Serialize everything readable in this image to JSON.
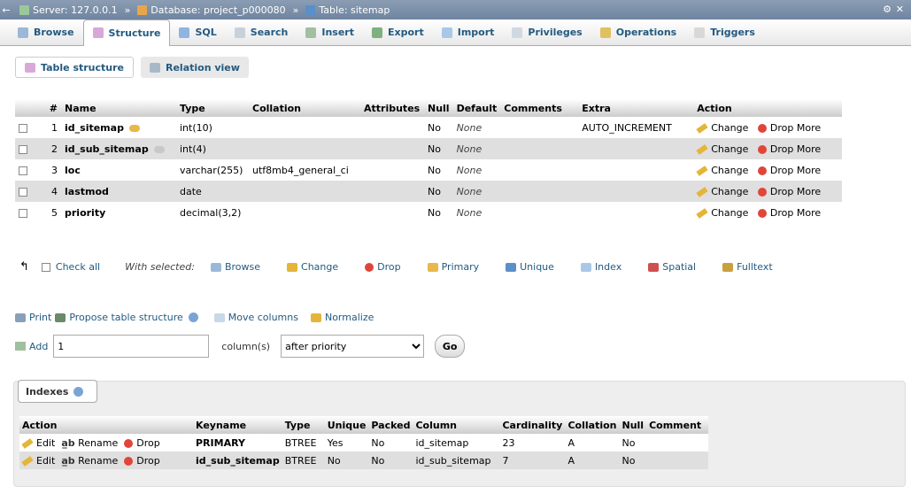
{
  "breadcrumb": {
    "server": "Server: 127.0.0.1",
    "database": "Database: project_p000080",
    "table": "Table: sitemap"
  },
  "tabs": [
    "Browse",
    "Structure",
    "SQL",
    "Search",
    "Insert",
    "Export",
    "Import",
    "Privileges",
    "Operations",
    "Triggers"
  ],
  "subtabs": {
    "table_structure": "Table structure",
    "relation_view": "Relation view"
  },
  "structure": {
    "headers": [
      "#",
      "Name",
      "Type",
      "Collation",
      "Attributes",
      "Null",
      "Default",
      "Comments",
      "Extra",
      "Action"
    ],
    "rows": [
      {
        "num": "1",
        "name": "id_sitemap",
        "type": "int(10)",
        "collation": "",
        "attributes": "",
        "null": "No",
        "default": "None",
        "comments": "",
        "extra": "AUTO_INCREMENT"
      },
      {
        "num": "2",
        "name": "id_sub_sitemap",
        "type": "int(4)",
        "collation": "",
        "attributes": "",
        "null": "No",
        "default": "None",
        "comments": "",
        "extra": ""
      },
      {
        "num": "3",
        "name": "loc",
        "type": "varchar(255)",
        "collation": "utf8mb4_general_ci",
        "attributes": "",
        "null": "No",
        "default": "None",
        "comments": "",
        "extra": ""
      },
      {
        "num": "4",
        "name": "lastmod",
        "type": "date",
        "collation": "",
        "attributes": "",
        "null": "No",
        "default": "None",
        "comments": "",
        "extra": ""
      },
      {
        "num": "5",
        "name": "priority",
        "type": "decimal(3,2)",
        "collation": "",
        "attributes": "",
        "null": "No",
        "default": "None",
        "comments": "",
        "extra": ""
      }
    ],
    "actions": {
      "change": "Change",
      "drop": "Drop",
      "more": "More"
    }
  },
  "with_selected": {
    "check_all": "Check all",
    "label": "With selected:",
    "items": [
      "Browse",
      "Change",
      "Drop",
      "Primary",
      "Unique",
      "Index",
      "Spatial",
      "Fulltext"
    ]
  },
  "misc": {
    "print": "Print",
    "propose": "Propose table structure",
    "move": "Move columns",
    "normalize": "Normalize"
  },
  "add": {
    "label": "Add",
    "value": "1",
    "columns_label": "column(s)",
    "position": "after priority",
    "go": "Go"
  },
  "indexes": {
    "legend": "Indexes",
    "headers": [
      "Action",
      "Keyname",
      "Type",
      "Unique",
      "Packed",
      "Column",
      "Cardinality",
      "Collation",
      "Null",
      "Comment"
    ],
    "actions": {
      "edit": "Edit",
      "rename": "Rename",
      "drop": "Drop"
    },
    "rows": [
      {
        "keyname": "PRIMARY",
        "type": "BTREE",
        "unique": "Yes",
        "packed": "No",
        "column": "id_sitemap",
        "cardinality": "23",
        "collation": "A",
        "null": "No",
        "comment": ""
      },
      {
        "keyname": "id_sub_sitemap",
        "type": "BTREE",
        "unique": "No",
        "packed": "No",
        "column": "id_sub_sitemap",
        "cardinality": "7",
        "collation": "A",
        "null": "No",
        "comment": ""
      }
    ]
  }
}
